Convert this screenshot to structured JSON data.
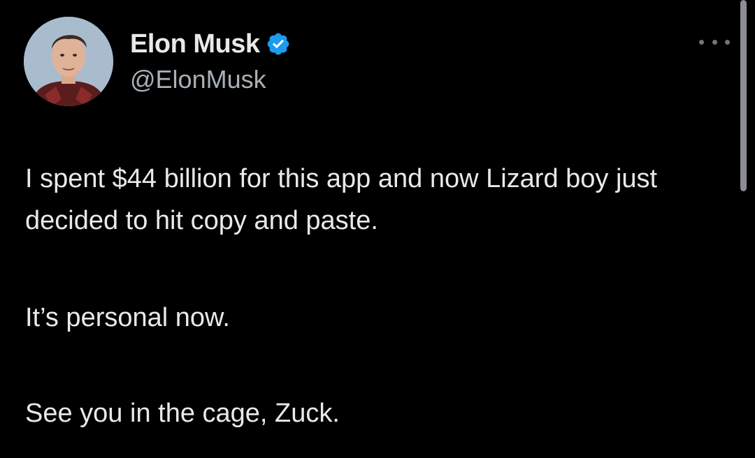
{
  "author": {
    "display_name": "Elon Musk",
    "handle": "@ElonMusk",
    "verified": true,
    "avatar_icon": "profile-photo-avatar"
  },
  "menu": {
    "icon": "more-options-icon"
  },
  "tweet": {
    "paragraphs": [
      "I spent $44 billion for this app and now Lizard boy just decided to hit copy and paste.",
      "It’s personal now.",
      "See you in the cage, Zuck."
    ]
  },
  "colors": {
    "background": "#000000",
    "text_primary": "#e7e9ea",
    "text_secondary": "#a9b0b6",
    "verified_badge": "#1d9bf0"
  }
}
